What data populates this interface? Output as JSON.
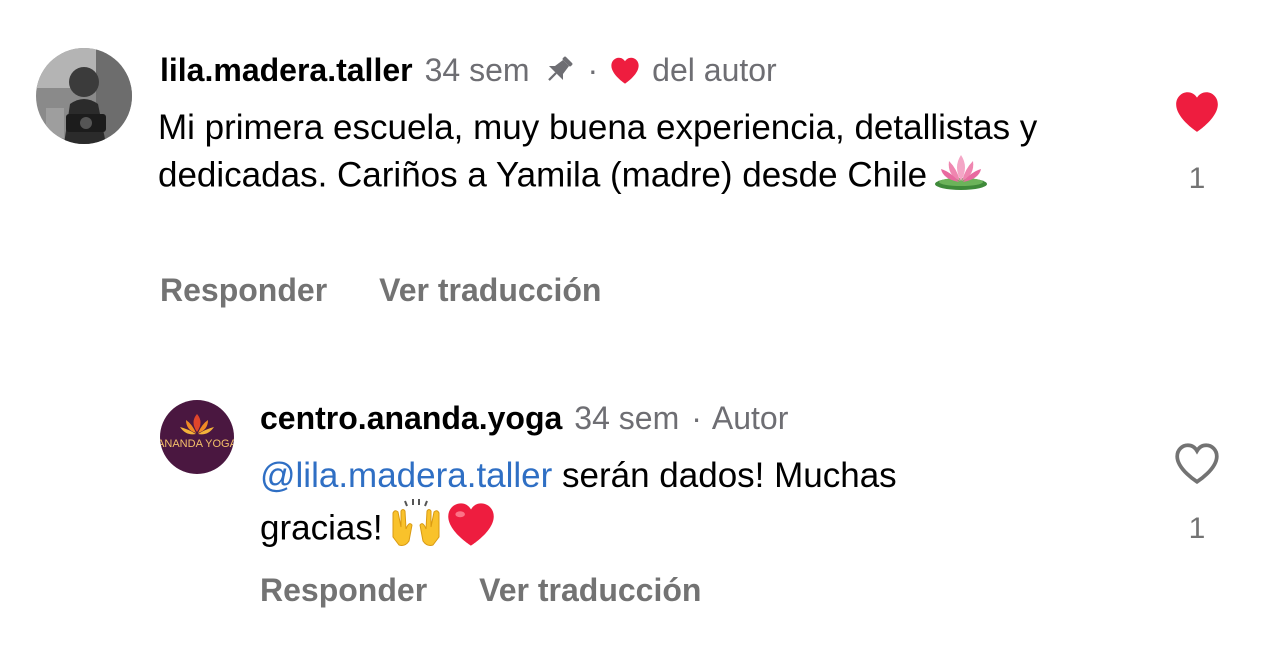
{
  "comment": {
    "username": "lila.madera.taller",
    "time": "34 sem",
    "author_liked_label": "del autor",
    "text": "Mi primera escuela, muy buena experiencia, detallistas y dedicadas. Cariños a Yamila (madre) desde Chile",
    "emoji": "lotus",
    "reply_label": "Responder",
    "translate_label": "Ver traducción",
    "like_count": "1",
    "liked": true
  },
  "reply": {
    "username": "centro.ananda.yoga",
    "time": "34 sem",
    "author_label": "Autor",
    "mention": "@lila.madera.taller",
    "text_line1": " serán dados! Muchas",
    "text_line2": "gracias!",
    "emojis": [
      "raising-hands",
      "red-heart"
    ],
    "avatar_logo_text": "ANANDA YOGA",
    "reply_label": "Responder",
    "translate_label": "Ver traducción",
    "like_count": "1",
    "liked": false
  },
  "colors": {
    "heart_red": "#ee1d3f",
    "mention_blue": "#2f6fc4",
    "muted_gray": "#737373",
    "avatar_purple": "#4a1740"
  }
}
